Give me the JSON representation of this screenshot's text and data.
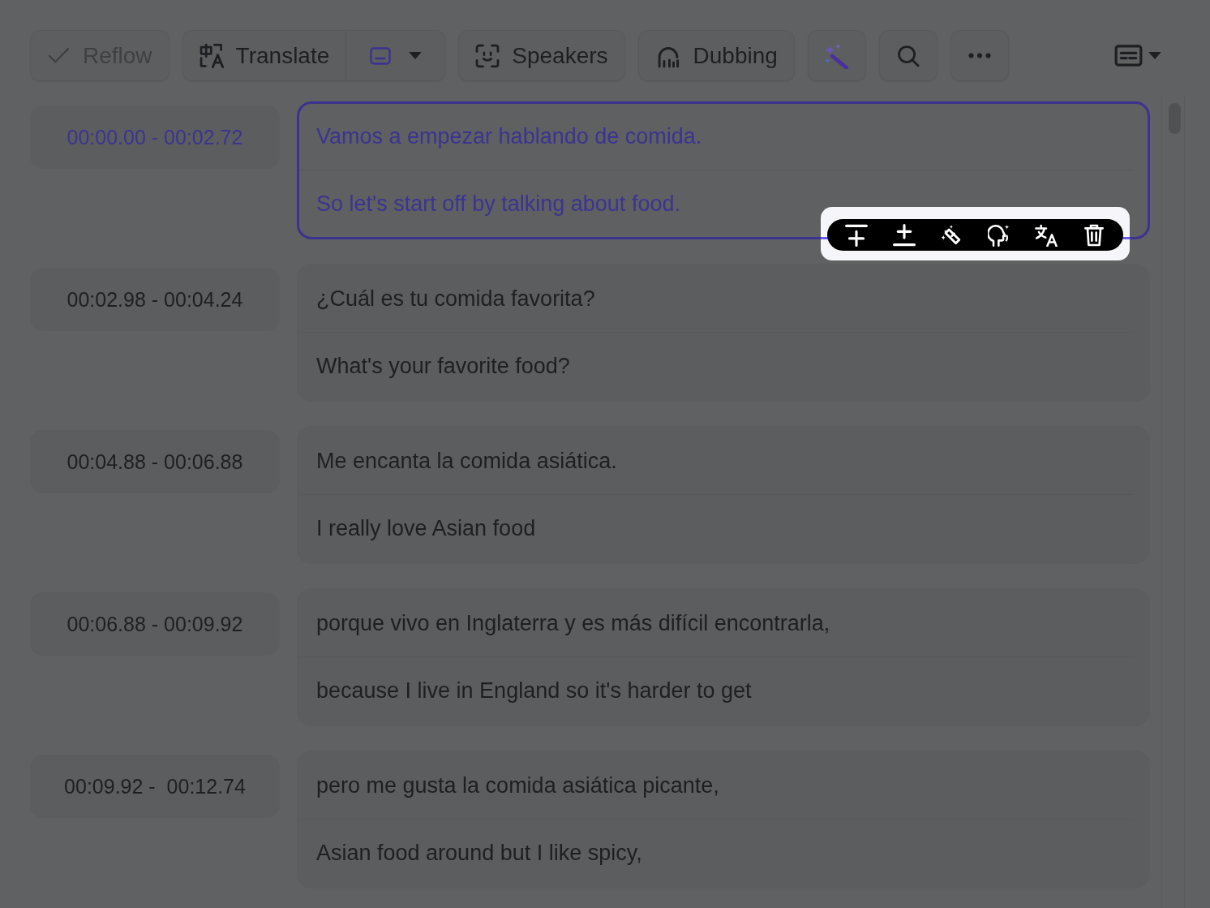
{
  "toolbar": {
    "reflow": {
      "label": "Reflow",
      "disabled": true
    },
    "translate": {
      "label": "Translate",
      "disabled": false
    },
    "speakers": {
      "label": "Speakers",
      "disabled": false
    },
    "dubbing": {
      "label": "Dubbing",
      "disabled": false
    }
  },
  "segments": [
    {
      "time": "00:00.00 - 00:02.72",
      "source": "Vamos a empezar hablando de comida.",
      "translation": "So let's start off by talking about food.",
      "selected": true
    },
    {
      "time": "00:02.98 - 00:04.24",
      "source": "¿Cuál es tu comida favorita?",
      "translation": "What's your favorite food?",
      "selected": false
    },
    {
      "time": "00:04.88 - 00:06.88",
      "source": "Me encanta la comida asiática.",
      "translation": "I really love Asian food",
      "selected": false
    },
    {
      "time": "00:06.88 - 00:09.92",
      "source": "porque vivo en Inglaterra y es más difícil encontrarla,",
      "translation": "because I live in England so it's harder to get",
      "selected": false
    },
    {
      "time": "00:09.92 -  00:12.74",
      "source": "pero me gusta la comida asiática picante,",
      "translation": "Asian food around but I like spicy,",
      "selected": false
    }
  ]
}
